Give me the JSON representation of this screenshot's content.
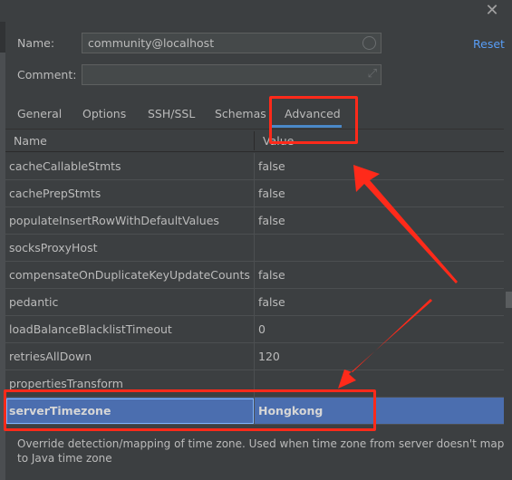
{
  "dialog": {
    "close_icon": "close-icon"
  },
  "form": {
    "name_label": "Name:",
    "name_value": "community@localhost",
    "comment_label": "Comment:",
    "comment_value": "",
    "reset_label": "Reset"
  },
  "tabs": [
    {
      "label": "General"
    },
    {
      "label": "Options"
    },
    {
      "label": "SSH/SSL"
    },
    {
      "label": "Schemas"
    },
    {
      "label": "Advanced",
      "active": true
    }
  ],
  "table": {
    "headers": [
      "Name",
      "Value"
    ],
    "rows": [
      {
        "name": "cacheCallableStmts",
        "value": "false"
      },
      {
        "name": "cachePrepStmts",
        "value": "false"
      },
      {
        "name": "populateInsertRowWithDefaultValues",
        "value": "false"
      },
      {
        "name": "socksProxyHost",
        "value": ""
      },
      {
        "name": "compensateOnDuplicateKeyUpdateCounts",
        "value": "false"
      },
      {
        "name": "pedantic",
        "value": "false"
      },
      {
        "name": "loadBalanceBlacklistTimeout",
        "value": "0"
      },
      {
        "name": "retriesAllDown",
        "value": "120"
      },
      {
        "name": "propertiesTransform",
        "value": ""
      },
      {
        "name": "serverTimezone",
        "value": "Hongkong",
        "selected": true
      }
    ]
  },
  "description": "Override detection/mapping of time zone. Used when time zone from server doesn't map to Java time zone",
  "colors": {
    "accent": "#4a88c7",
    "selection": "#4b6eaf",
    "link": "#589df6",
    "annotation": "#ff2a1a"
  }
}
